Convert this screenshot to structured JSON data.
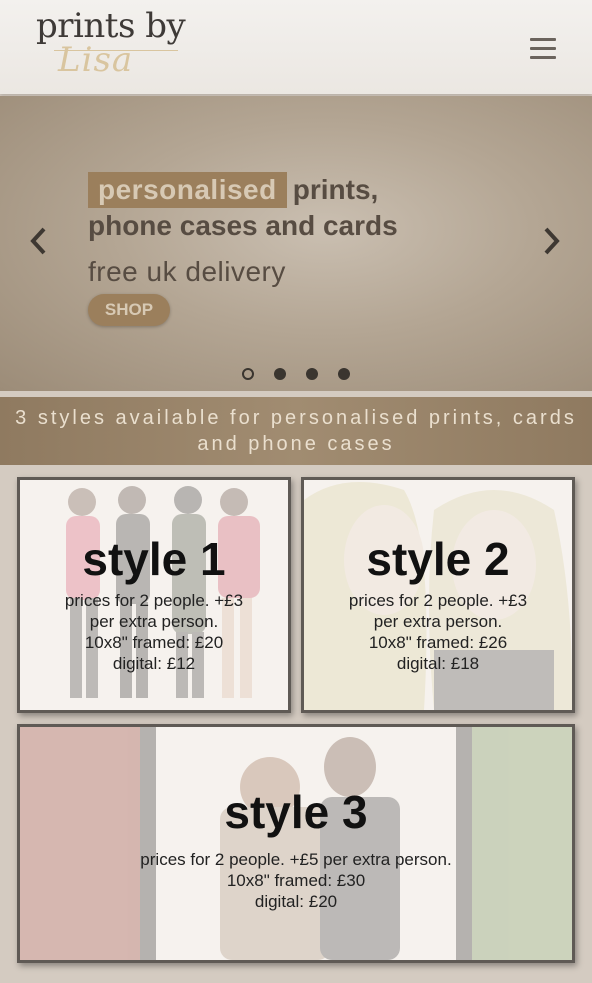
{
  "header": {
    "logo_top": "prints by",
    "logo_script": "Lisa",
    "menu_icon": "hamburger-menu-icon"
  },
  "hero": {
    "highlight": "personalised",
    "line1_rest": "prints,",
    "line2": "phone cases and cards",
    "line3": "free uk delivery",
    "shop_label": "SHOP",
    "prev_icon": "chevron-left-icon",
    "next_icon": "chevron-right-icon",
    "slide_count": 4,
    "active_slide": 1
  },
  "banner": {
    "text": "3 styles available for personalised prints, cards and phone cases"
  },
  "styles": [
    {
      "title": "style 1",
      "lines": [
        "prices for 2 people. +£3",
        "per extra person.",
        "10x8\" framed: £20",
        "digital: £12"
      ]
    },
    {
      "title": "style 2",
      "lines": [
        "prices for 2 people. +£3",
        "per extra person.",
        "10x8\" framed: £26",
        "digital: £18"
      ]
    },
    {
      "title": "style 3",
      "lines": [
        "prices for 2 people. +£5 per extra person.",
        "10x8\" framed: £30",
        "digital: £20"
      ]
    }
  ],
  "colors": {
    "accent": "#9b7f5c",
    "banner": "#9a8468",
    "page_bg": "#d4cbc1"
  }
}
